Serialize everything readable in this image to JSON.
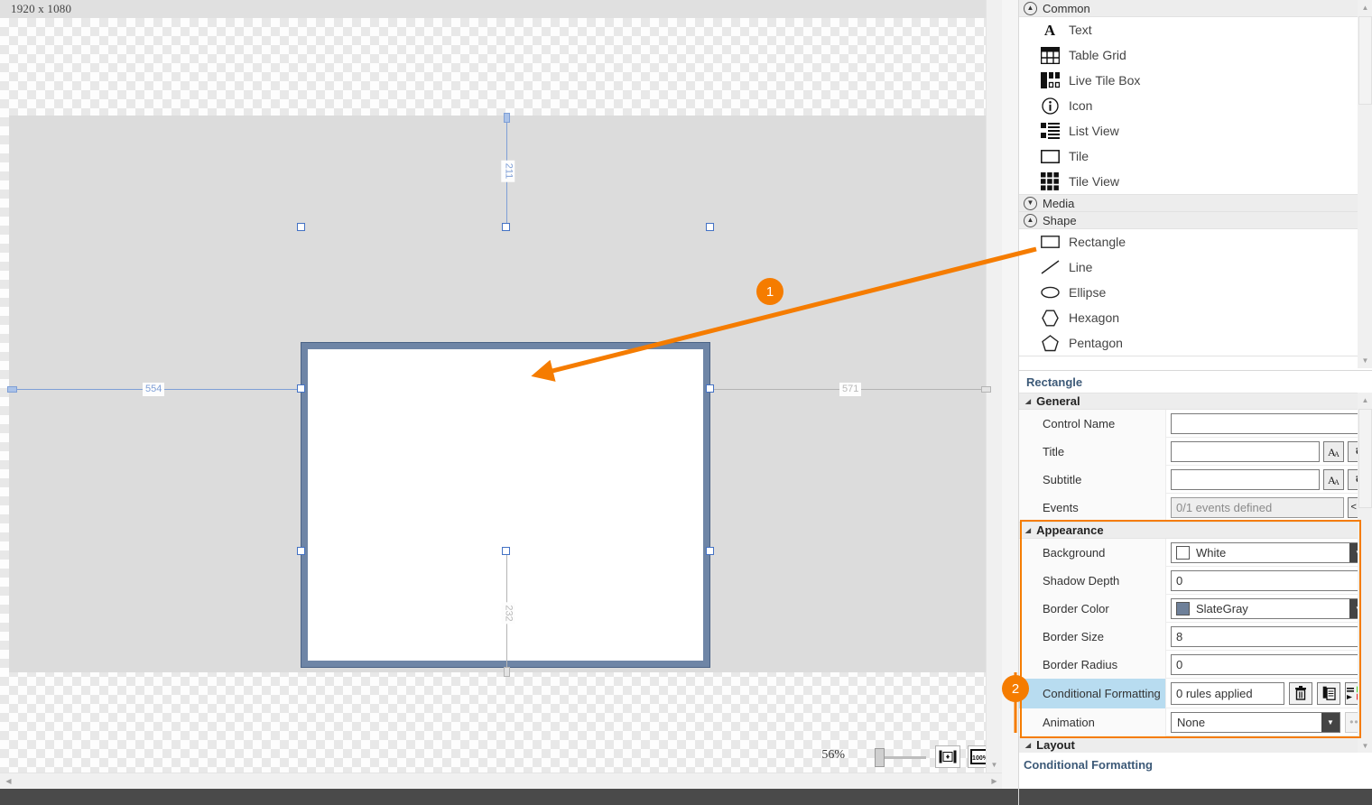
{
  "canvas": {
    "size_label": "1920 x 1080",
    "zoom_percent": "56%",
    "zoom_100_label": "100%",
    "fit_button_name": "fit-to-screen",
    "guides": {
      "top": "211",
      "left": "554",
      "right": "571",
      "bottom": "232"
    },
    "shape": {
      "type": "rectangle",
      "fill": "#FFFFFF",
      "border_color": "#6E85A6"
    }
  },
  "annotations": {
    "badge_1": "1",
    "badge_2": "2",
    "accent_color": "#F57C00"
  },
  "toolbox": {
    "groups": [
      {
        "label": "Common",
        "expanded": true,
        "items": [
          {
            "label": "Text",
            "icon": "text-icon"
          },
          {
            "label": "Table Grid",
            "icon": "table-grid-icon"
          },
          {
            "label": "Live Tile Box",
            "icon": "live-tile-box-icon"
          },
          {
            "label": "Icon",
            "icon": "info-circle-icon"
          },
          {
            "label": "List View",
            "icon": "list-view-icon"
          },
          {
            "label": "Tile",
            "icon": "tile-icon"
          },
          {
            "label": "Tile View",
            "icon": "tile-view-icon"
          }
        ]
      },
      {
        "label": "Media",
        "expanded": false,
        "items": []
      },
      {
        "label": "Shape",
        "expanded": true,
        "items": [
          {
            "label": "Rectangle",
            "icon": "rectangle-icon"
          },
          {
            "label": "Line",
            "icon": "line-icon"
          },
          {
            "label": "Ellipse",
            "icon": "ellipse-icon"
          },
          {
            "label": "Hexagon",
            "icon": "hexagon-icon"
          },
          {
            "label": "Pentagon",
            "icon": "pentagon-icon"
          }
        ]
      }
    ]
  },
  "properties": {
    "title": "Rectangle",
    "sections": {
      "general": {
        "label": "General",
        "rows": {
          "control_name": {
            "label": "Control Name",
            "value": ""
          },
          "title": {
            "label": "Title",
            "value": ""
          },
          "subtitle": {
            "label": "Subtitle",
            "value": ""
          },
          "events": {
            "label": "Events",
            "value": "0/1 events defined"
          }
        }
      },
      "appearance": {
        "label": "Appearance",
        "rows": {
          "background": {
            "label": "Background",
            "value": "White",
            "swatch": "#FFFFFF"
          },
          "shadow_depth": {
            "label": "Shadow Depth",
            "value": "0"
          },
          "border_color": {
            "label": "Border Color",
            "value": "SlateGray",
            "swatch": "#6E8099"
          },
          "border_size": {
            "label": "Border Size",
            "value": "8"
          },
          "border_radius": {
            "label": "Border Radius",
            "value": "0"
          },
          "conditional_formatting": {
            "label": "Conditional Formatting",
            "value": "0 rules applied"
          },
          "animation": {
            "label": "Animation",
            "value": "None"
          }
        }
      },
      "layout": {
        "label": "Layout"
      }
    },
    "footer_label": "Conditional Formatting"
  }
}
